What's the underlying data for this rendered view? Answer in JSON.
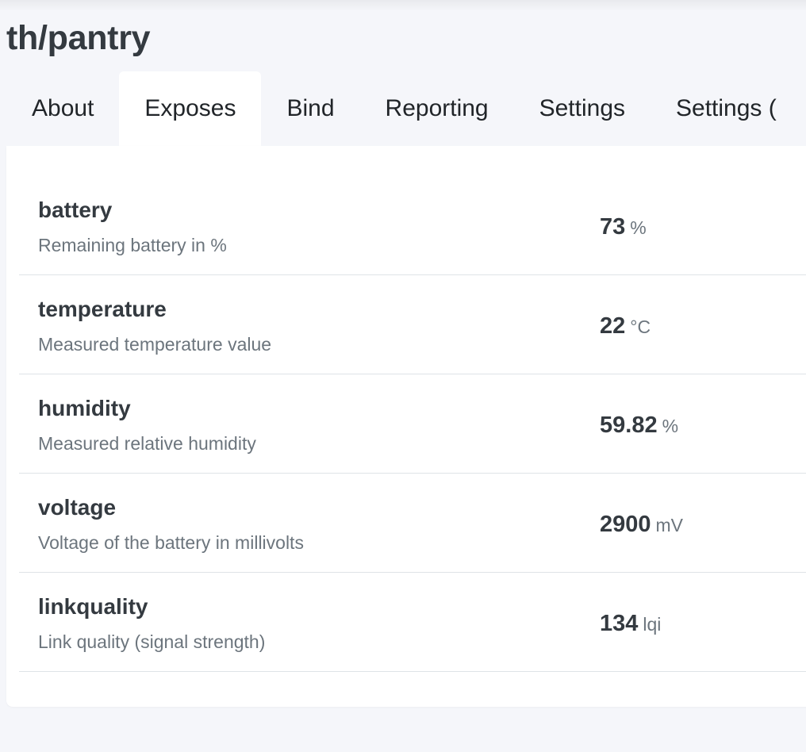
{
  "device": {
    "title": "th/pantry"
  },
  "tabs": [
    {
      "label": "About",
      "active": false
    },
    {
      "label": "Exposes",
      "active": true
    },
    {
      "label": "Bind",
      "active": false
    },
    {
      "label": "Reporting",
      "active": false
    },
    {
      "label": "Settings",
      "active": false
    },
    {
      "label": "Settings (",
      "active": false
    }
  ],
  "exposes": [
    {
      "name": "battery",
      "description": "Remaining battery in %",
      "value": "73",
      "unit": "%"
    },
    {
      "name": "temperature",
      "description": "Measured temperature value",
      "value": "22",
      "unit": "°C"
    },
    {
      "name": "humidity",
      "description": "Measured relative humidity",
      "value": "59.82",
      "unit": "%"
    },
    {
      "name": "voltage",
      "description": "Voltage of the battery in millivolts",
      "value": "2900",
      "unit": "mV"
    },
    {
      "name": "linkquality",
      "description": "Link quality (signal strength)",
      "value": "134",
      "unit": "lqi"
    }
  ]
}
